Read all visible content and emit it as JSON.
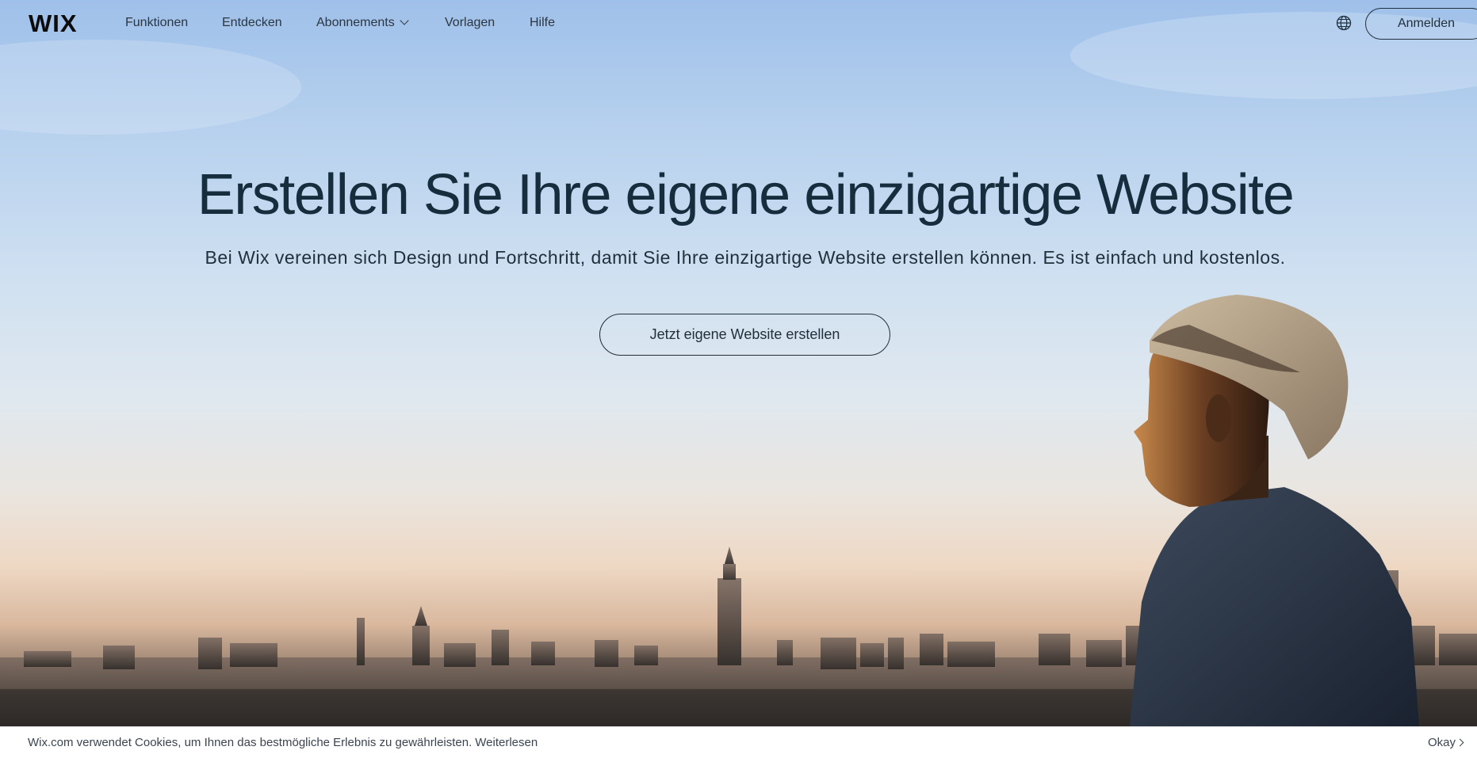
{
  "header": {
    "logo_text": "WIX",
    "nav": [
      {
        "label": "Funktionen"
      },
      {
        "label": "Entdecken"
      },
      {
        "label": "Abonnements",
        "has_dropdown": true
      },
      {
        "label": "Vorlagen"
      },
      {
        "label": "Hilfe"
      }
    ],
    "language_icon": "globe-icon",
    "login_label": "Anmelden"
  },
  "hero": {
    "headline": "Erstellen Sie Ihre eigene einzigartige Website",
    "subline": "Bei Wix vereinen sich Design und Fortschritt, damit Sie Ihre einzigartige Website erstellen können. Es ist einfach und kostenlos.",
    "cta_label": "Jetzt eigene Website erstellen"
  },
  "cookie_bar": {
    "text": "Wix.com verwendet Cookies, um Ihnen das bestmögliche Erlebnis zu gewährleisten.",
    "link_label": "Weiterlesen",
    "okay_label": "Okay"
  },
  "colors": {
    "text": "#162d3d",
    "sky_top": "#9fc0ea",
    "horizon": "#eed8c4"
  }
}
